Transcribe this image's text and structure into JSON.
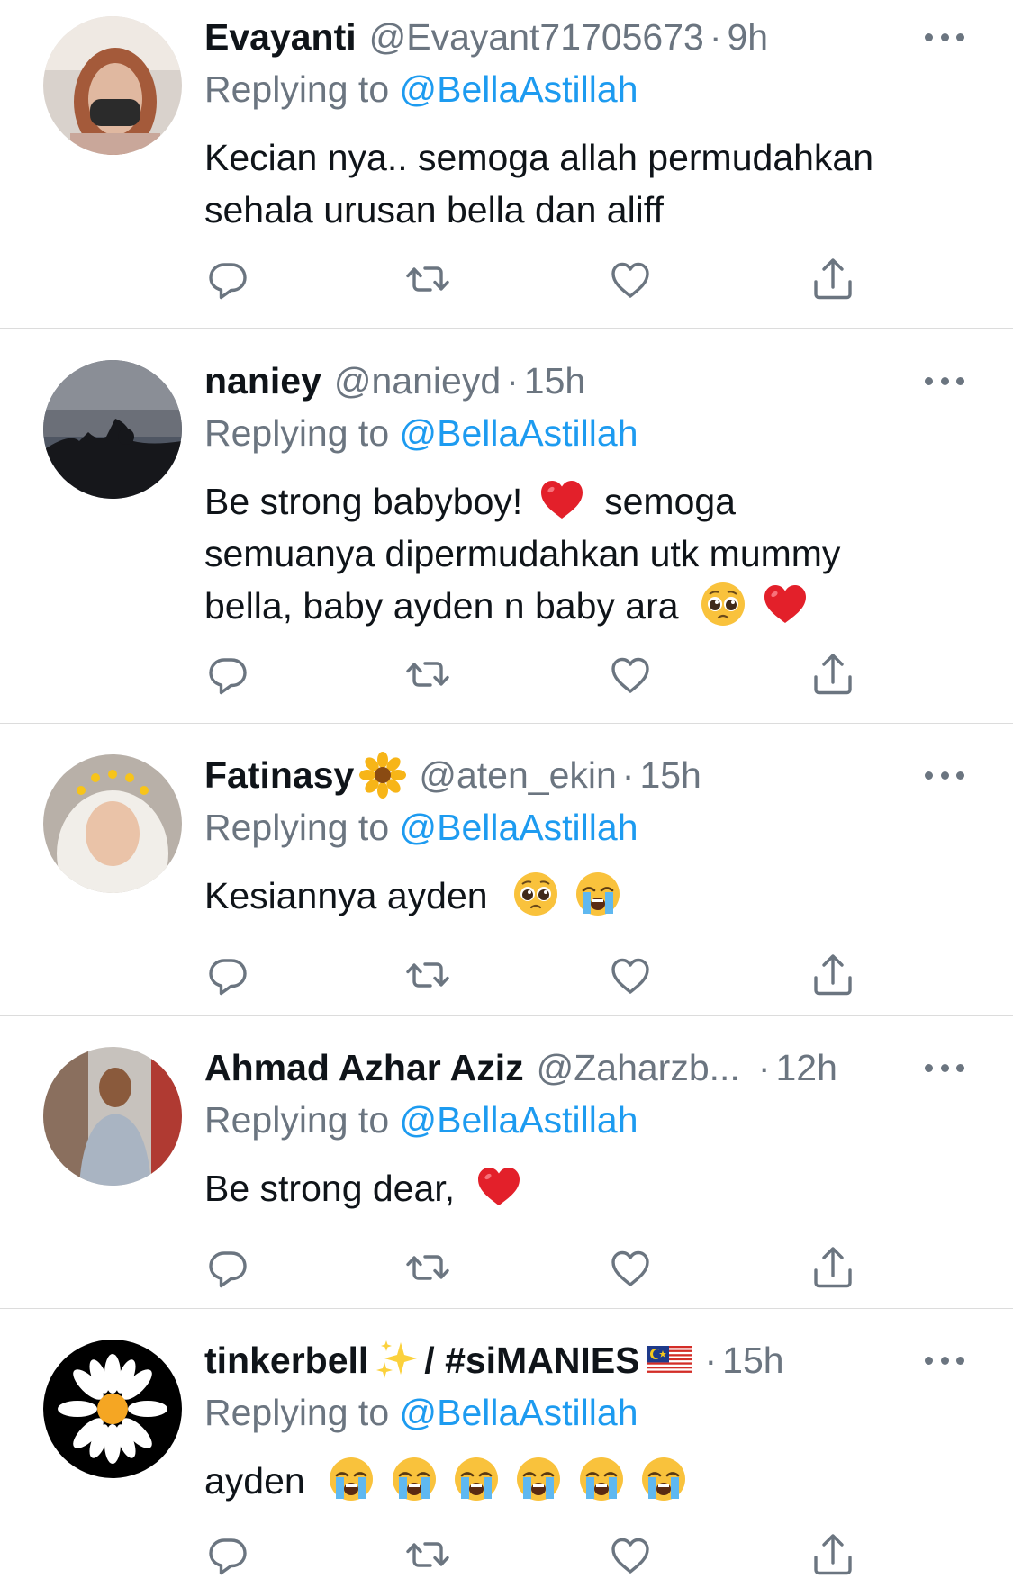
{
  "replying_label": "Replying to",
  "tweets": [
    {
      "name": "Evayanti",
      "handle": "@Evayant71705673",
      "separator": "·",
      "time": "9h",
      "mention": "@BellaAstillah",
      "text": "Kecian nya.. semoga allah permudahkan sehala urusan bella dan aliff"
    },
    {
      "name": "naniey",
      "handle": "@nanieyd",
      "separator": "·",
      "time": "15h",
      "mention": "@BellaAstillah",
      "text_line1": "Be strong babyboy!",
      "text_line1b": "semoga",
      "text_line2": "semuanya dipermudahkan utk mummy",
      "text_line3": "bella, baby ayden n baby ara"
    },
    {
      "name": "Fatinasy",
      "handle": "@aten_ekin",
      "separator": "·",
      "time": "15h",
      "mention": "@BellaAstillah",
      "text": "Kesiannya ayden"
    },
    {
      "name": "Ahmad Azhar Aziz",
      "handle": "@Zaharzb...",
      "separator": "·",
      "time": "12h",
      "mention": "@BellaAstillah",
      "text": "Be strong dear,"
    },
    {
      "name": "tinkerbell",
      "name_suffix": "/ #siMANIES",
      "separator": "·",
      "time": "15h",
      "mention": "@BellaAstillah",
      "text": "ayden"
    }
  ],
  "icons": [
    "reply-icon",
    "retweet-icon",
    "like-icon",
    "share-icon",
    "more-icon"
  ],
  "colors": {
    "mention": "#1d9bf0",
    "muted": "#6b7580",
    "text": "#0f1419",
    "divider": "#dcdcdc"
  }
}
